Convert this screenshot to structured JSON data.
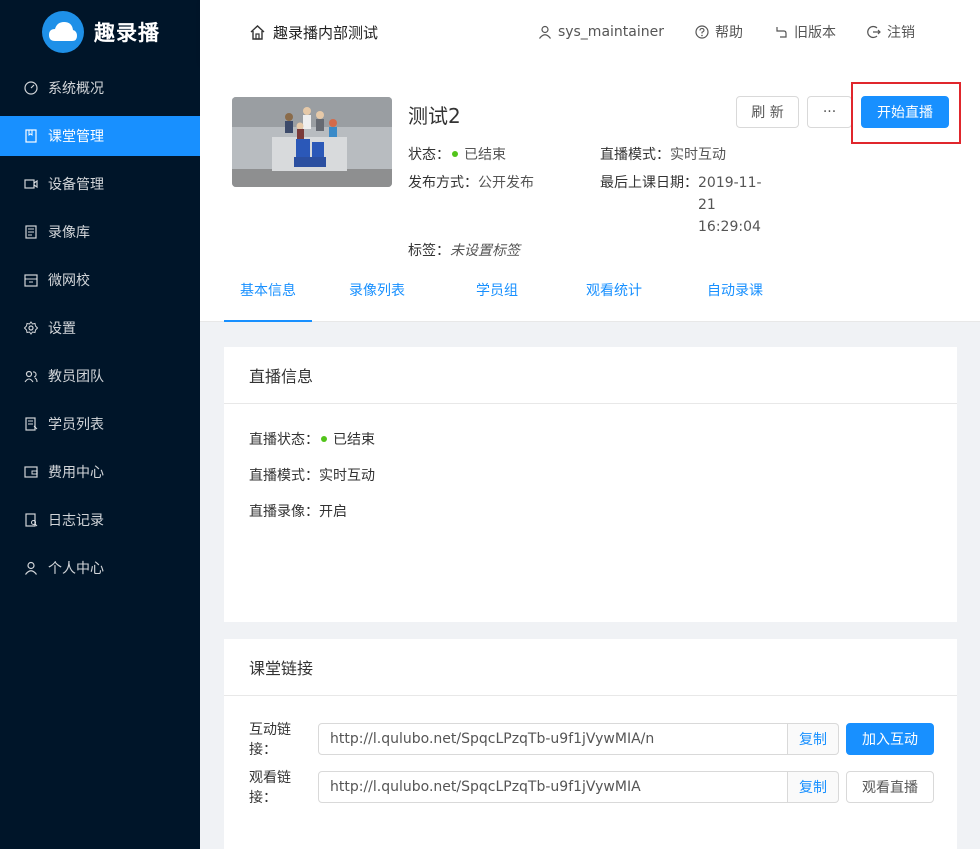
{
  "app": {
    "name": "趣录播"
  },
  "sidebar": {
    "items": [
      {
        "label": "系统概况",
        "icon": "dashboard-icon",
        "active": false
      },
      {
        "label": "课堂管理",
        "icon": "book-icon",
        "active": true
      },
      {
        "label": "设备管理",
        "icon": "camera-icon",
        "active": false
      },
      {
        "label": "录像库",
        "icon": "video-library-icon",
        "active": false
      },
      {
        "label": "微网校",
        "icon": "school-icon",
        "active": false
      },
      {
        "label": "设置",
        "icon": "gear-icon",
        "active": false
      },
      {
        "label": "教员团队",
        "icon": "team-icon",
        "active": false
      },
      {
        "label": "学员列表",
        "icon": "student-list-icon",
        "active": false
      },
      {
        "label": "费用中心",
        "icon": "wallet-icon",
        "active": false
      },
      {
        "label": "日志记录",
        "icon": "log-icon",
        "active": false
      },
      {
        "label": "个人中心",
        "icon": "user-icon",
        "active": false
      }
    ]
  },
  "header": {
    "breadcrumb": "趣录播内部测试",
    "username": "sys_maintainer",
    "help": "帮助",
    "old_version": "旧版本",
    "logout": "注销"
  },
  "course": {
    "title": "测试2",
    "status_label": "状态：",
    "status_value": "已结束",
    "publish_label": "发布方式：",
    "publish_value": "公开发布",
    "mode_label": "直播模式：",
    "mode_value": "实时互动",
    "last_date_label": "最后上课日期：",
    "last_date_line1": "2019-11-",
    "last_date_line2": "21",
    "last_date_line3": "16:29:04",
    "tags_label": "标签：",
    "tags_value": "未设置标签"
  },
  "actions": {
    "refresh": "刷 新",
    "more": "···",
    "start_live": "开始直播"
  },
  "tabs": [
    "基本信息",
    "录像列表",
    "学员组",
    "观看统计",
    "自动录课"
  ],
  "live_info": {
    "title": "直播信息",
    "status_label": "直播状态：",
    "status_value": "已结束",
    "mode_label": "直播模式：",
    "mode_value": "实时互动",
    "record_label": "直播录像：",
    "record_value": "开启"
  },
  "links": {
    "title": "课堂链接",
    "interactive_label": "互动链接：",
    "interactive_url": "http://l.qulubo.net/SpqcLPzqTb-u9f1jVywMIA/n",
    "watch_label": "观看链接：",
    "watch_url": "http://l.qulubo.net/SpqcLPzqTb-u9f1jVywMIA",
    "copy": "复制",
    "join": "加入互动",
    "watch": "观看直播"
  },
  "colors": {
    "primary": "#1890ff",
    "sidebar": "#001529",
    "success": "#52c41a",
    "highlight": "#e0262c"
  }
}
